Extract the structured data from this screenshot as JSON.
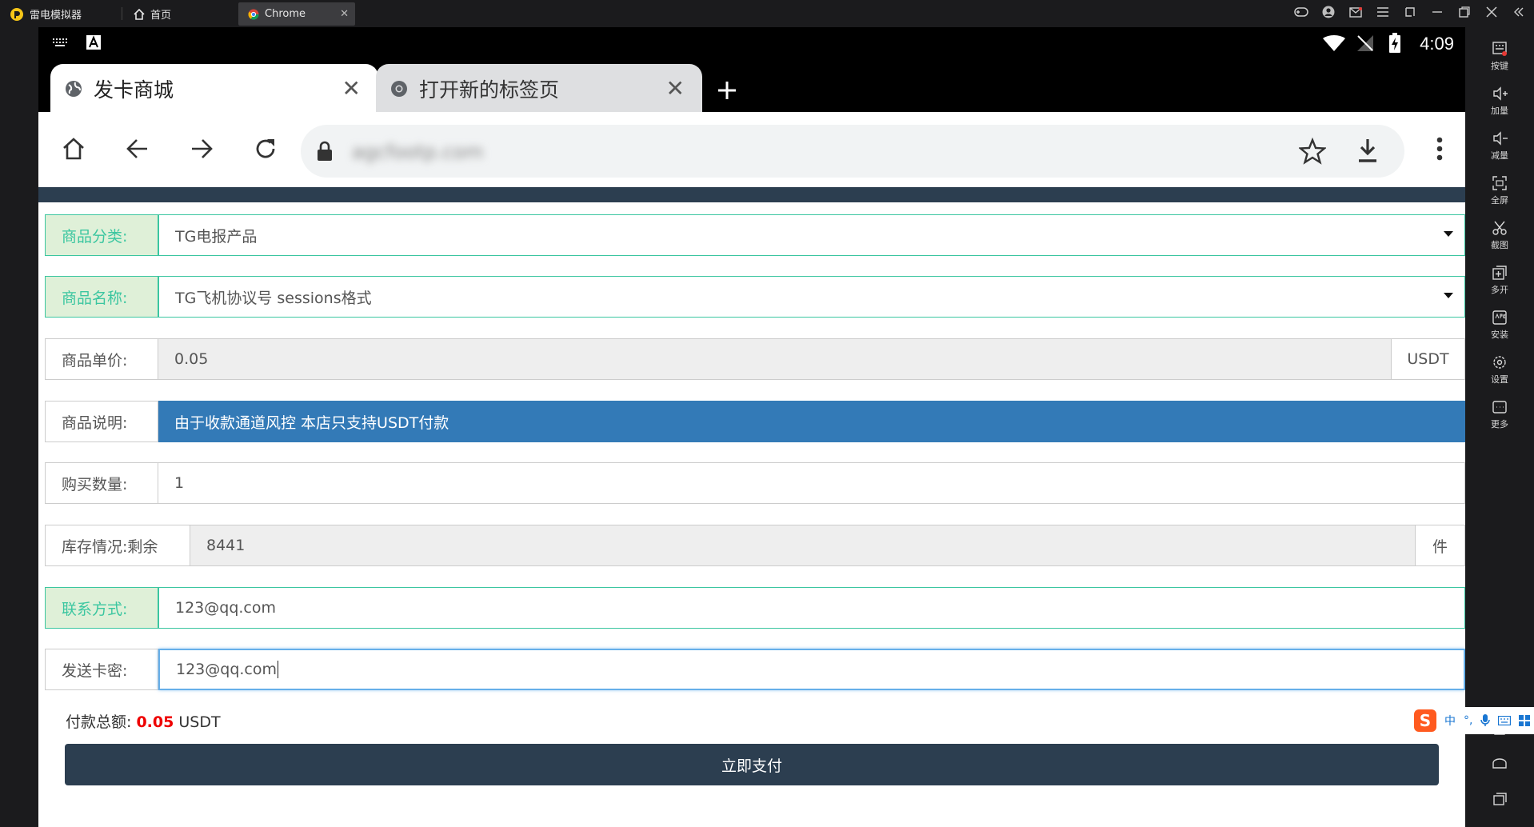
{
  "emulator": {
    "app_name": "雷电模拟器",
    "tabs": [
      {
        "label": "首页"
      },
      {
        "label": "Chrome"
      }
    ]
  },
  "sidebar": {
    "items": [
      {
        "label": "按键",
        "icon": "keyboard-icon"
      },
      {
        "label": "加量",
        "icon": "volume-up-icon"
      },
      {
        "label": "减量",
        "icon": "volume-down-icon"
      },
      {
        "label": "全屏",
        "icon": "fullscreen-icon"
      },
      {
        "label": "截图",
        "icon": "scissors-icon"
      },
      {
        "label": "多开",
        "icon": "multi-open-icon"
      },
      {
        "label": "安装",
        "icon": "apk-icon"
      },
      {
        "label": "设置",
        "icon": "gear-icon"
      },
      {
        "label": "更多",
        "icon": "more-icon"
      }
    ]
  },
  "status_bar": {
    "time": "4:09"
  },
  "browser": {
    "tabs": [
      {
        "title": "发卡商城",
        "active": true
      },
      {
        "title": "打开新的标签页",
        "active": false
      }
    ],
    "url": "agcfootp.com"
  },
  "form": {
    "category": {
      "label": "商品分类:",
      "value": "TG电报产品"
    },
    "product": {
      "label": "商品名称:",
      "value": "TG飞机协议号 sessions格式"
    },
    "price": {
      "label": "商品单价:",
      "value": "0.05",
      "unit": "USDT"
    },
    "description": {
      "label": "商品说明:",
      "value": "由于收款通道风控 本店只支持USDT付款"
    },
    "quantity": {
      "label": "购买数量:",
      "value": "1"
    },
    "stock": {
      "label": "库存情况:剩余",
      "value": "8441",
      "unit": "件"
    },
    "contact": {
      "label": "联系方式:",
      "value": "123@qq.com"
    },
    "send_card": {
      "label": "发送卡密:",
      "value": "123@qq.com"
    },
    "total": {
      "label": "付款总额:",
      "amount": "0.05",
      "unit": "USDT"
    },
    "pay_button": "立即支付"
  },
  "ime": {
    "items": [
      "中",
      "°,"
    ]
  },
  "colors": {
    "accent_green": "#3bc6a0",
    "info_blue": "#337ab7",
    "header_dark": "#2c3e50",
    "total_red": "#ee0000"
  }
}
